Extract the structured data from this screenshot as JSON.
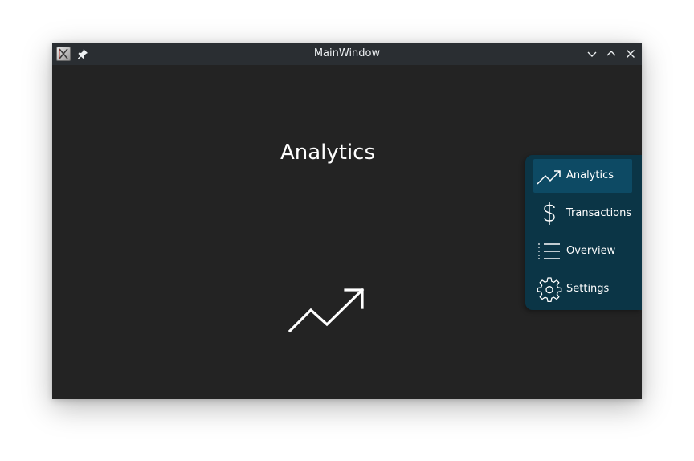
{
  "window": {
    "title": "MainWindow",
    "icons": {
      "app": "app-icon",
      "pin": "pin-icon",
      "minimize": "chevron-down-icon",
      "maximize": "chevron-up-icon",
      "close": "close-icon"
    }
  },
  "main": {
    "heading": "Analytics",
    "icon": "trending-up-icon"
  },
  "sidebar": {
    "items": [
      {
        "label": "Analytics",
        "icon": "trending-up-icon",
        "active": true
      },
      {
        "label": "Transactions",
        "icon": "dollar-icon",
        "active": false
      },
      {
        "label": "Overview",
        "icon": "list-icon",
        "active": false
      },
      {
        "label": "Settings",
        "icon": "gear-icon",
        "active": false
      }
    ]
  },
  "colors": {
    "background": "#232323",
    "titlebar": "#2a2e32",
    "sidebar": "#0b3546",
    "active_item": "#0d4a64",
    "text": "#ffffff"
  }
}
